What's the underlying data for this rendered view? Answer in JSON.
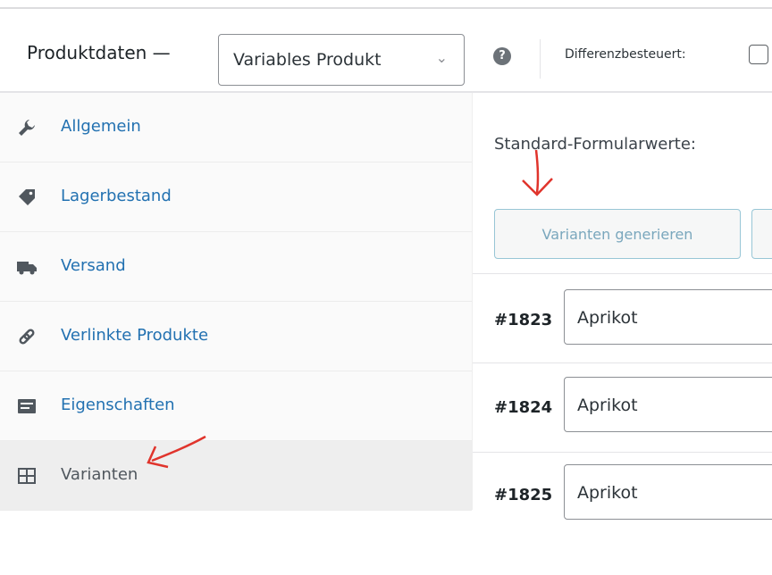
{
  "header": {
    "label": "Produktdaten —",
    "product_type": "Variables Produkt",
    "help_icon": "question-circle-icon",
    "diff_label": "Differenzbesteuert:"
  },
  "sidebar": {
    "items": [
      {
        "label": "Allgemein",
        "icon": "wrench-icon"
      },
      {
        "label": "Lagerbestand",
        "icon": "tag-icon"
      },
      {
        "label": "Versand",
        "icon": "truck-icon"
      },
      {
        "label": "Verlinkte Produkte",
        "icon": "link-icon"
      },
      {
        "label": "Eigenschaften",
        "icon": "list-icon"
      },
      {
        "label": "Varianten",
        "icon": "grid-icon"
      }
    ]
  },
  "main": {
    "standard_label": "Standard-Formularwerte:",
    "generate_button": "Varianten generieren",
    "variations": [
      {
        "id": "#1823",
        "value": "Aprikot"
      },
      {
        "id": "#1824",
        "value": "Aprikot"
      },
      {
        "id": "#1825",
        "value": "Aprikot"
      }
    ]
  },
  "colors": {
    "link": "#2271b1",
    "annotation": "#e0342c",
    "button_border": "#98c6d6"
  }
}
